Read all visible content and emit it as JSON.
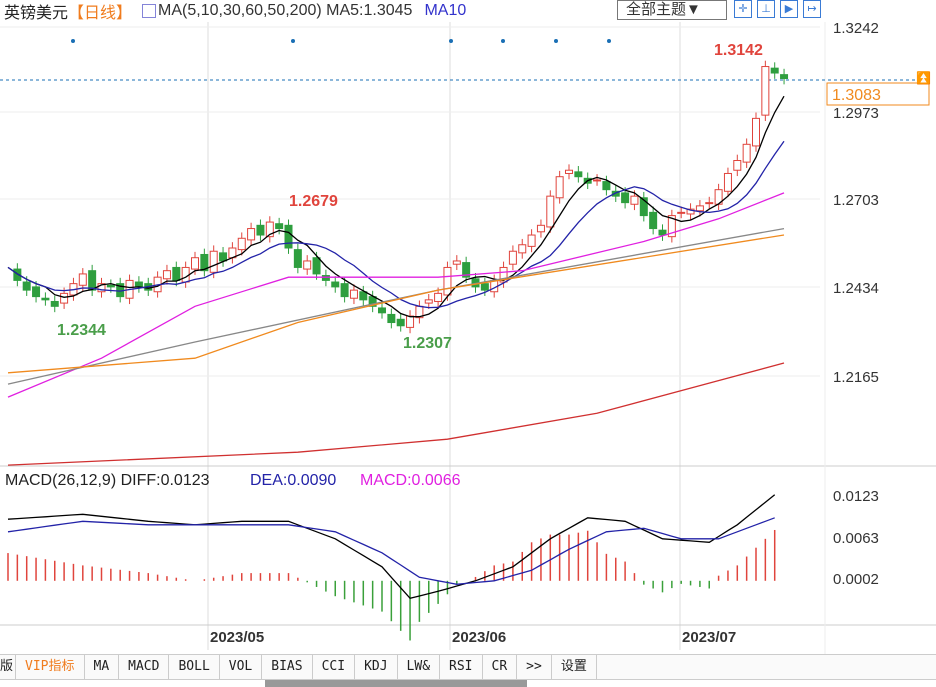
{
  "header": {
    "symbol": "英镑美元",
    "period": "【日线】",
    "ma_label": "MA(5,10,30,60,50,200)",
    "ma5": "MA5:1.3045",
    "ma10": "MA10",
    "theme": "全部主题▼"
  },
  "toolbar": [
    {
      "icon": "crosshair-icon",
      "g": "✛"
    },
    {
      "icon": "zoom-icon",
      "g": "⊥"
    },
    {
      "icon": "play-icon",
      "g": "▶"
    },
    {
      "icon": "exit-icon",
      "g": "↦"
    }
  ],
  "price_axis": [
    "1.3242",
    "1.2973",
    "1.2703",
    "1.2434",
    "1.2165"
  ],
  "current_price": "1.3083",
  "annotations": {
    "high": "1.3142",
    "mid_high": "1.2679",
    "low1": "1.2344",
    "low2": "1.2307"
  },
  "macd_header": {
    "name": "MACD(26,12,9)",
    "diff": "DIFF:0.0123",
    "dea": "DEA:0.0090",
    "macd": "MACD:0.0066"
  },
  "macd_axis": [
    "0.0123",
    "0.0063",
    "0.0002"
  ],
  "date_labels": [
    "2023/05",
    "2023/06",
    "2023/07"
  ],
  "tabs": [
    "版",
    "VIP指标",
    "MA",
    "MACD",
    "BOLL",
    "VOL",
    "BIAS",
    "CCI",
    "KDJ",
    "LW&",
    "RSI",
    "CR",
    ">>",
    "设置"
  ],
  "colors": {
    "up": "#e0443c",
    "down": "#2e9e3e",
    "ma5": "#000000",
    "ma10": "#2323a8",
    "ma30": "#e020e0",
    "ma60": "#888888",
    "ma50": "#f08a1e",
    "ma200": "#d03030"
  },
  "chart_data": {
    "type": "candlestick",
    "close": [
      1.25,
      1.246,
      1.243,
      1.241,
      1.24,
      1.238,
      1.242,
      1.245,
      1.248,
      1.243,
      1.245,
      1.244,
      1.241,
      1.246,
      1.244,
      1.243,
      1.247,
      1.249,
      1.246,
      1.25,
      1.253,
      1.249,
      1.255,
      1.252,
      1.256,
      1.259,
      1.262,
      1.26,
      1.264,
      1.262,
      1.256,
      1.25,
      1.252,
      1.248,
      1.246,
      1.244,
      1.241,
      1.243,
      1.24,
      1.238,
      1.236,
      1.233,
      1.232,
      1.235,
      1.238,
      1.24,
      1.242,
      1.25,
      1.252,
      1.247,
      1.244,
      1.243,
      1.246,
      1.25,
      1.255,
      1.257,
      1.26,
      1.263,
      1.272,
      1.278,
      1.28,
      1.278,
      1.276,
      1.277,
      1.274,
      1.272,
      1.27,
      1.272,
      1.266,
      1.262,
      1.26,
      1.266,
      1.267,
      1.268,
      1.269,
      1.27,
      1.274,
      1.279,
      1.283,
      1.288,
      1.296,
      1.312,
      1.31,
      1.3083
    ],
    "ma30": [
      [
        0,
        1.21
      ],
      [
        10,
        1.222
      ],
      [
        20,
        1.238
      ],
      [
        30,
        1.247
      ],
      [
        46,
        1.247
      ],
      [
        55,
        1.249
      ],
      [
        68,
        1.258
      ],
      [
        76,
        1.265
      ],
      [
        83,
        1.273
      ]
    ],
    "ma60": [
      [
        0,
        1.214
      ],
      [
        20,
        1.227
      ],
      [
        46,
        1.243
      ],
      [
        83,
        1.262
      ]
    ],
    "ma50": [
      [
        0,
        1.2175
      ],
      [
        20,
        1.222
      ],
      [
        31,
        1.233
      ],
      [
        46,
        1.243
      ],
      [
        83,
        1.26
      ]
    ],
    "ma200": [
      [
        0,
        1.189
      ],
      [
        31,
        1.193
      ],
      [
        47,
        1.197
      ],
      [
        63,
        1.205
      ],
      [
        83,
        1.2205
      ]
    ],
    "diff": [
      [
        0,
        0.0088
      ],
      [
        8,
        0.0095
      ],
      [
        15,
        0.0085
      ],
      [
        20,
        0.008
      ],
      [
        25,
        0.0085
      ],
      [
        30,
        0.0085
      ],
      [
        35,
        0.006
      ],
      [
        40,
        0.002
      ],
      [
        43,
        -0.0025
      ],
      [
        46,
        -0.0015
      ],
      [
        50,
        0.0
      ],
      [
        54,
        0.002
      ],
      [
        58,
        0.006
      ],
      [
        62,
        0.009
      ],
      [
        66,
        0.0085
      ],
      [
        70,
        0.006
      ],
      [
        75,
        0.0055
      ],
      [
        78,
        0.008
      ],
      [
        82,
        0.0123
      ]
    ],
    "dea": [
      [
        0,
        0.007
      ],
      [
        8,
        0.0085
      ],
      [
        15,
        0.008
      ],
      [
        22,
        0.008
      ],
      [
        30,
        0.008
      ],
      [
        35,
        0.007
      ],
      [
        40,
        0.004
      ],
      [
        44,
        0.0005
      ],
      [
        48,
        -0.0005
      ],
      [
        52,
        0.0
      ],
      [
        56,
        0.0015
      ],
      [
        60,
        0.0045
      ],
      [
        64,
        0.007
      ],
      [
        68,
        0.0075
      ],
      [
        72,
        0.006
      ],
      [
        76,
        0.006
      ],
      [
        82,
        0.009
      ]
    ],
    "ylim": [
      1.1855,
      1.3242
    ],
    "macd_ylim": [
      -0.004,
      0.0123
    ]
  }
}
